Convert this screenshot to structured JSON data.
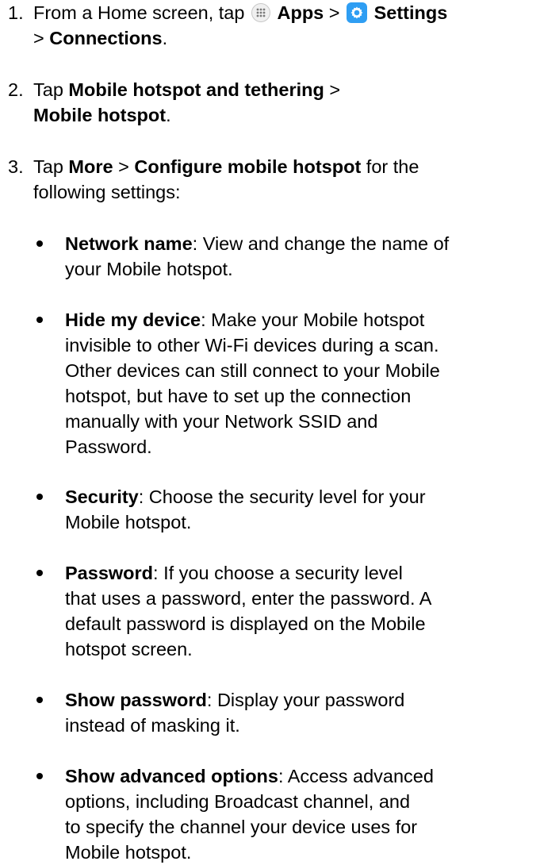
{
  "steps": [
    {
      "number": "1.",
      "t1": "From a Home screen, tap ",
      "apps": "Apps",
      "sep1": " > ",
      "settings": "Settings",
      "sep2": "> ",
      "connections": "Connections",
      "end": "."
    },
    {
      "number": "2.",
      "t1": "Tap ",
      "b1": "Mobile hotspot and tethering",
      "sep1": " >",
      "b2": "Mobile hotspot",
      "end": "."
    },
    {
      "number": "3.",
      "t1": "Tap ",
      "b1": "More",
      "sep1": " > ",
      "b2": "Configure mobile hotspot",
      "t2": " for the",
      "t3": "following settings:"
    }
  ],
  "settings_items": [
    {
      "term": "Network name",
      "lines": [
        ": View and change the name of",
        "your Mobile hotspot."
      ]
    },
    {
      "term": "Hide my device",
      "lines": [
        ": Make your Mobile hotspot",
        "invisible to other Wi-Fi devices during a scan.",
        "Other devices can still connect to your Mobile",
        "hotspot, but have to set up the connection",
        "manually with your Network SSID and",
        "Password."
      ]
    },
    {
      "term": "Security",
      "lines": [
        ": Choose the security level for your",
        "Mobile hotspot."
      ]
    },
    {
      "term": "Password",
      "lines": [
        ": If you choose a security level",
        "that uses a password, enter the password. A",
        "default password is displayed on the Mobile",
        "hotspot screen."
      ]
    },
    {
      "term": "Show password",
      "lines": [
        ": Display your password",
        "instead of masking it."
      ]
    },
    {
      "term": "Show advanced options",
      "lines": [
        ": Access advanced",
        "options, including Broadcast channel, and",
        "to specify the channel your device uses for",
        "Mobile hotspot."
      ]
    }
  ],
  "icons": {
    "apps": "apps-grid-icon",
    "settings": "settings-gear-icon",
    "settings_color": "#2f9ef3"
  }
}
